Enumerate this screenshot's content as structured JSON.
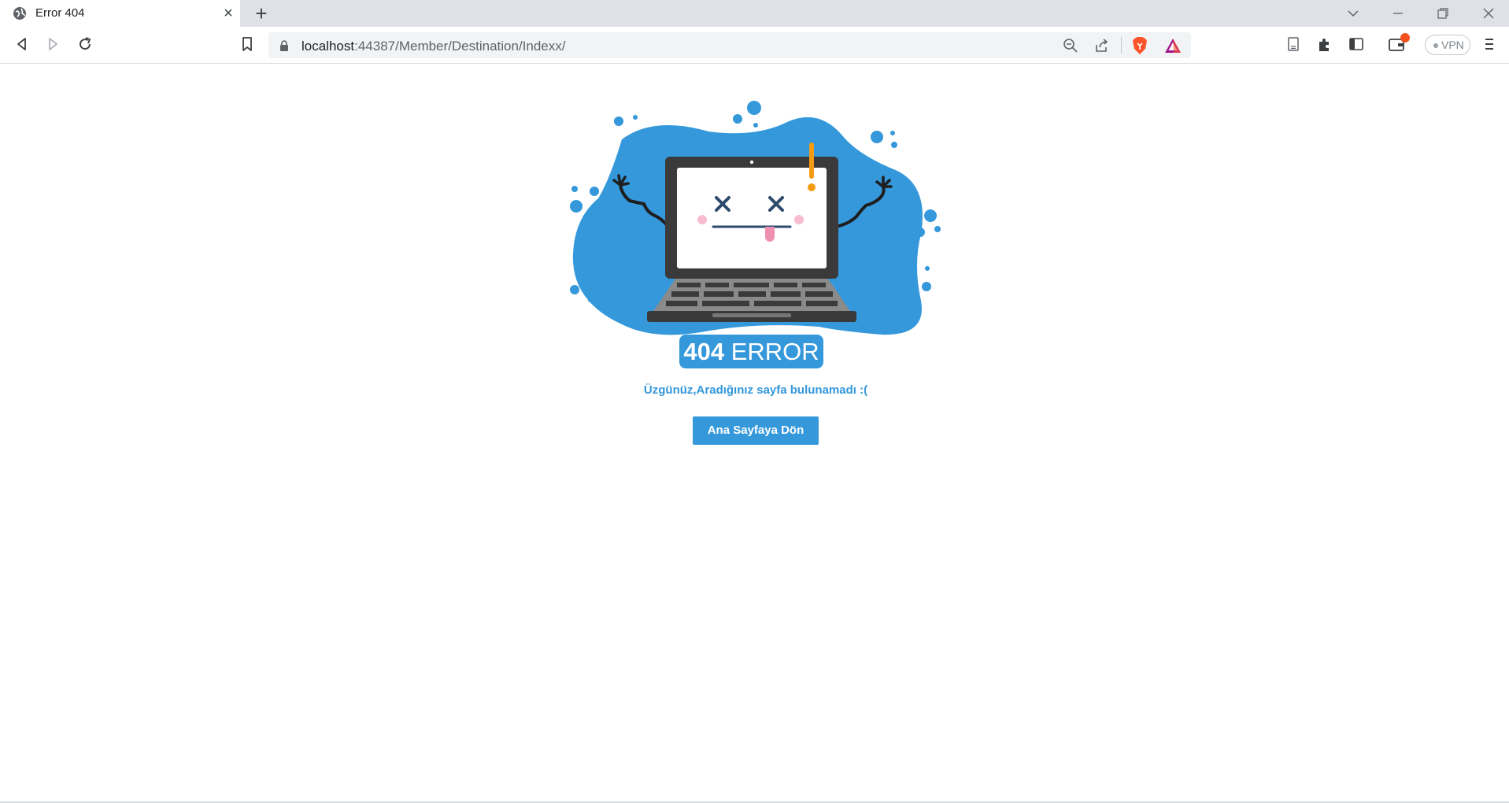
{
  "browser": {
    "tab": {
      "title": "Error 404"
    },
    "address_bar": {
      "host": "localhost",
      "path": ":44387/Member/Destination/Indexx/"
    },
    "vpn_label": "VPN"
  },
  "page": {
    "error_code": "404",
    "error_word": " ERROR",
    "message": "Üzgünüz,Aradığınız sayfa bulunamadı :(",
    "home_button_label": "Ana Sayfaya Dön"
  },
  "colors": {
    "accent": "#3498db",
    "laptop_dark": "#3a3a3a",
    "exclamation": "#f39c12"
  }
}
